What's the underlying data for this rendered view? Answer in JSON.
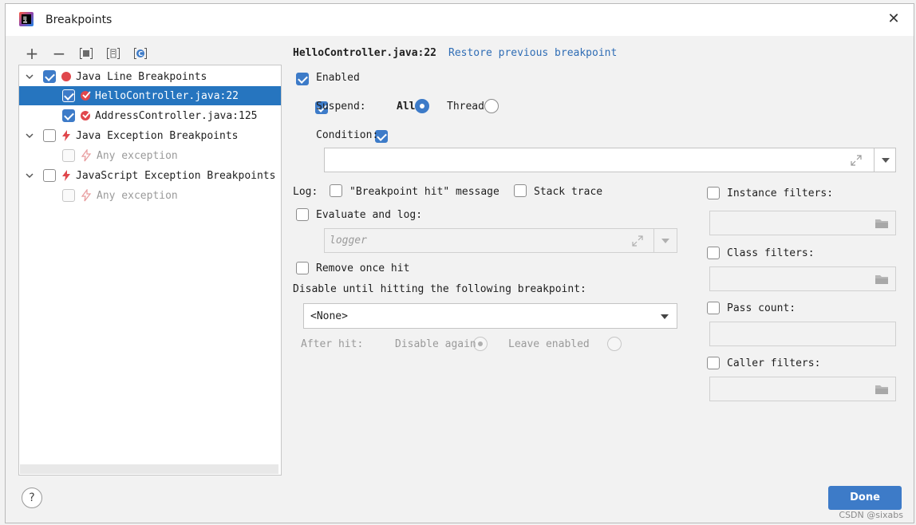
{
  "window": {
    "title": "Breakpoints",
    "close_glyph": "✕"
  },
  "toolbar": {
    "add": "+",
    "remove": "−"
  },
  "tree": {
    "java_line": "Java Line Breakpoints",
    "hello": "HelloController.java:22",
    "address": "AddressController.java:125",
    "java_exc": "Java Exception Breakpoints",
    "any1": "Any exception",
    "js_exc": "JavaScript Exception Breakpoints",
    "any2": "Any exception"
  },
  "detail": {
    "location": "HelloController.java:22",
    "restore_link": "Restore previous breakpoint",
    "enabled": "Enabled",
    "suspend": "Suspend:",
    "all": "All",
    "thread": "Thread",
    "condition": "Condition:",
    "log": "Log:",
    "bp_hit_msg": "\"Breakpoint hit\" message",
    "stack_trace": "Stack trace",
    "evaluate_log": "Evaluate and log:",
    "logger_placeholder": "logger",
    "remove_once_hit": "Remove once hit",
    "disable_until": "Disable until hitting the following breakpoint:",
    "none_option": "<None>",
    "after_hit": "After hit:",
    "disable_again": "Disable again",
    "leave_enabled": "Leave enabled",
    "instance_filters": "Instance filters:",
    "class_filters": "Class filters:",
    "pass_count": "Pass count:",
    "caller_filters": "Caller filters:"
  },
  "footer": {
    "help": "?",
    "done": "Done"
  },
  "watermark": "CSDN @sixabs",
  "colors": {
    "accent": "#3d7bc8",
    "selection": "#2675bf",
    "breakpoint_red": "#e0474c",
    "link": "#2f6db5"
  },
  "icons": [
    "intellij-logo-icon",
    "add-icon",
    "remove-icon",
    "group-by-package-icon",
    "group-by-file-icon",
    "group-by-class-icon",
    "breakpoint-icon",
    "lightning-icon",
    "expand-icon",
    "dropdown-arrow-icon",
    "folder-icon",
    "help-icon",
    "chevron-down-icon"
  ]
}
